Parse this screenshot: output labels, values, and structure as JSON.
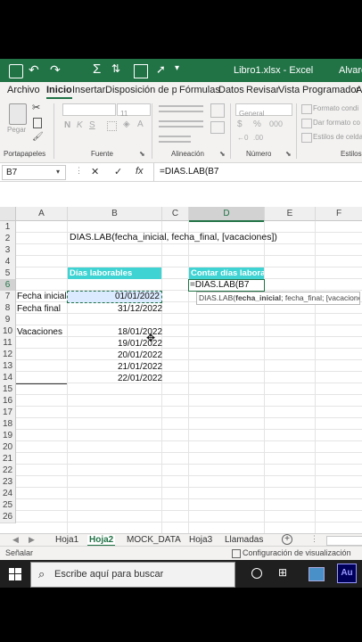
{
  "title_bar": {
    "file_title": "Libro1.xlsx  -  Excel",
    "user": "Alvaro"
  },
  "ribbon_tabs": [
    "Archivo",
    "Inicio",
    "Insertar",
    "Disposición de pág",
    "Fórmulas",
    "Datos",
    "Revisar",
    "Vista",
    "Programador",
    "A"
  ],
  "ribbon": {
    "paste": "Pegar",
    "font_size": "11",
    "number_format": "General",
    "styles": [
      "Formato condi",
      "Dar formato co",
      "Estilos de celda"
    ],
    "groups": [
      "Portapapeles",
      "Fuente",
      "Alineación",
      "Número",
      "Estilos"
    ]
  },
  "formula_bar": {
    "name_box": "B7",
    "cancel": "✕",
    "enter": "✓",
    "fx": "fx",
    "formula": "=DIAS.LAB(B7"
  },
  "columns": [
    "A",
    "B",
    "C",
    "D",
    "E",
    "F"
  ],
  "rows": [
    "1",
    "2",
    "3",
    "4",
    "5",
    "6",
    "7",
    "8",
    "9",
    "10",
    "11",
    "12",
    "13",
    "14",
    "15",
    "16",
    "17",
    "18",
    "19",
    "20",
    "21",
    "22",
    "23",
    "24",
    "25",
    "26"
  ],
  "cells": {
    "syntax": "DIAS.LAB(fecha_inicial, fecha_final, [vacaciones])",
    "header_b5": "Días laborables",
    "header_d5": "Contar días laborabl",
    "label_a7": "Fecha inicial",
    "value_b7": "01/01/2022",
    "label_a8": "Fecha final",
    "value_b8": "31/12/2022",
    "label_a10": "Vacaciones",
    "holidays": [
      "18/01/2022",
      "19/01/2022",
      "20/01/2022",
      "21/01/2022",
      "22/01/2022"
    ],
    "editing_d6": "=DIAS.LAB(B7"
  },
  "tooltip": {
    "fn": "DIAS.LAB(",
    "arg1": "fecha_inicial",
    "rest": "; fecha_final; [vacaciones])"
  },
  "sheet_tabs": [
    "Hoja1",
    "Hoja2",
    "MOCK_DATA",
    "Hoja3",
    "Llamadas"
  ],
  "status": {
    "mode": "Señalar",
    "display_settings": "Configuración de visualización"
  },
  "taskbar": {
    "search_placeholder": "Escribe aquí para buscar"
  },
  "colors": {
    "excel_green": "#217346",
    "header_teal": "#3fd3d3"
  }
}
